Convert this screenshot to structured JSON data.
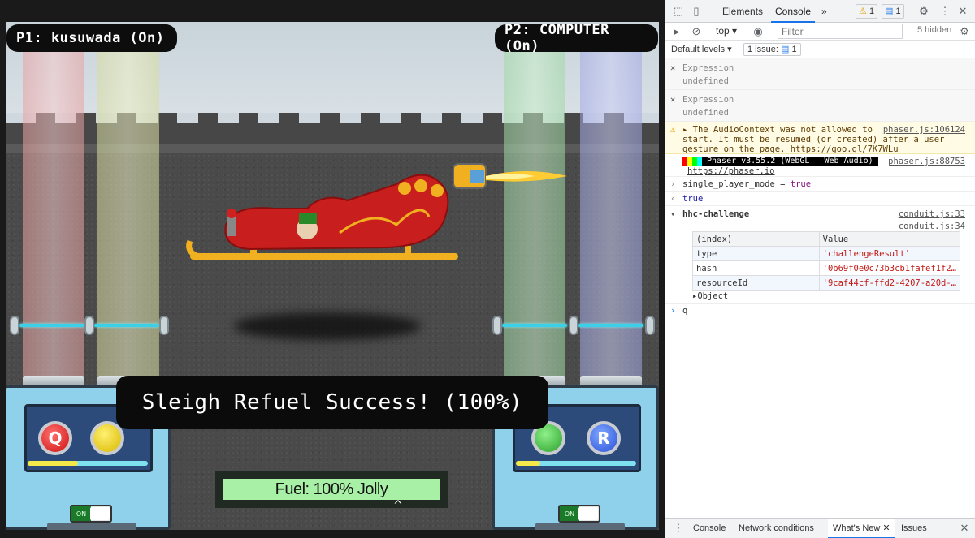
{
  "game": {
    "p1_tag": "P1: kusuwada (On)",
    "p2_tag": "P2: COMPUTER (On)",
    "success_message": "Sleigh Refuel Success! (100%)",
    "fuel_label": "Fuel: 100% Jolly",
    "fuel_level": 1.0,
    "caret": "^",
    "buttons": {
      "q": "Q",
      "r": "R"
    },
    "toggle_left": "ON",
    "toggle_right": "ON",
    "meter_left_fill": 0.42,
    "meter_right_fill": 0.2
  },
  "devtools": {
    "tabs": [
      "Elements",
      "Console"
    ],
    "active_tab": "Console",
    "more_tabs": "»",
    "warning_count": "1",
    "message_count": "1",
    "context": "top",
    "filter_placeholder": "Filter",
    "hidden_count": "5 hidden",
    "default_levels": "Default levels",
    "issues_label": "1 issue:",
    "issues_count": "1",
    "entries": {
      "expr1_label": "Expression",
      "expr1_value": "undefined",
      "expr2_label": "Expression",
      "expr2_value": "undefined",
      "warn_text_1": "The AudioContext was not allowed to",
      "warn_text_2": "start. It must be resumed (or created) after a user",
      "warn_text_3": "gesture on the page.",
      "warn_link": "https://goo.gl/7K7WLu",
      "warn_source": "phaser.js:106124",
      "phaser_banner": "Phaser v3.55.2 (WebGL | Web Audio)",
      "phaser_source": "phaser.js:88753",
      "phaser_link": "https://phaser.io",
      "cmd1_left": "single_player_mode",
      "cmd1_op": "=",
      "cmd1_right": "true",
      "result1": "true",
      "group_label": "hhc-challenge",
      "group_source": "conduit.js:33",
      "table_source": "conduit.js:34",
      "table_headers": [
        "(index)",
        "Value"
      ],
      "table_rows": [
        {
          "index": "type",
          "value": "'challengeResult'"
        },
        {
          "index": "hash",
          "value": "'0b69f0e0c73b3cb1fafef1f2…"
        },
        {
          "index": "resourceId",
          "value": "'9caf44cf-ffd2-4207-a20d-…"
        }
      ],
      "object_label": "Object",
      "prompt_input": "q"
    },
    "drawer_tabs": [
      "Console",
      "Network conditions",
      "What's New",
      "Issues"
    ],
    "drawer_active": "What's New"
  },
  "colors": {
    "devtools_accent": "#1a73e8",
    "fuel_bar": "#a8f0a6",
    "warning_bg": "#fffbe5"
  }
}
